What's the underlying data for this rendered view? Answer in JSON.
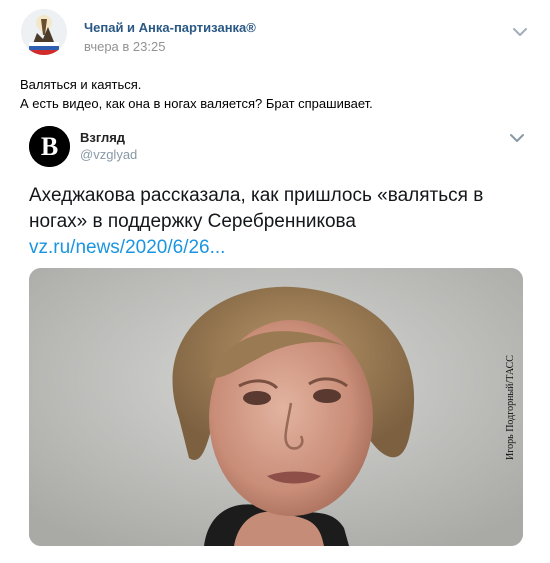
{
  "post": {
    "author": "Чепай и Анка-партизанка®",
    "time": "вчера в 23:25",
    "text_lines": [
      "Валяться и каяться.",
      "А есть видео, как она в ногах валяется? Брат спрашивает."
    ]
  },
  "embed": {
    "name": "Взгляд",
    "handle": "@vzglyad",
    "avatar_letter": "B",
    "text": "Ахеджакова рассказала, как пришлось «валяться в ногах» в поддержку Серебренникова",
    "link": "vz.ru/news/2020/6/26...",
    "photo_credit": "Игорь Подгорный/ТАСС"
  },
  "colors": {
    "author_link": "#2a5885",
    "meta_gray": "#939393",
    "tweet_link": "#1b95e0"
  },
  "icons": [
    "avatar-image",
    "chevron-down-icon",
    "chevron-down-icon"
  ]
}
